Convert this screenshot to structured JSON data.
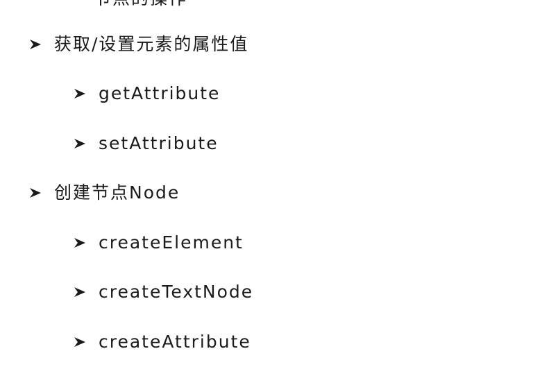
{
  "outline": {
    "top_partial_text": "节点的操作",
    "items": [
      {
        "label": "获取/设置元素的属性值"
      },
      {
        "label": "getAttribute"
      },
      {
        "label": "setAttribute"
      },
      {
        "label": "创建节点Node"
      },
      {
        "label": "createElement"
      },
      {
        "label": "createTextNode"
      },
      {
        "label": "createAttribute"
      }
    ]
  },
  "icons": {
    "bullet": "arrowhead-bullet-icon"
  },
  "colors": {
    "text": "#1a1a1a",
    "background": "#ffffff"
  }
}
